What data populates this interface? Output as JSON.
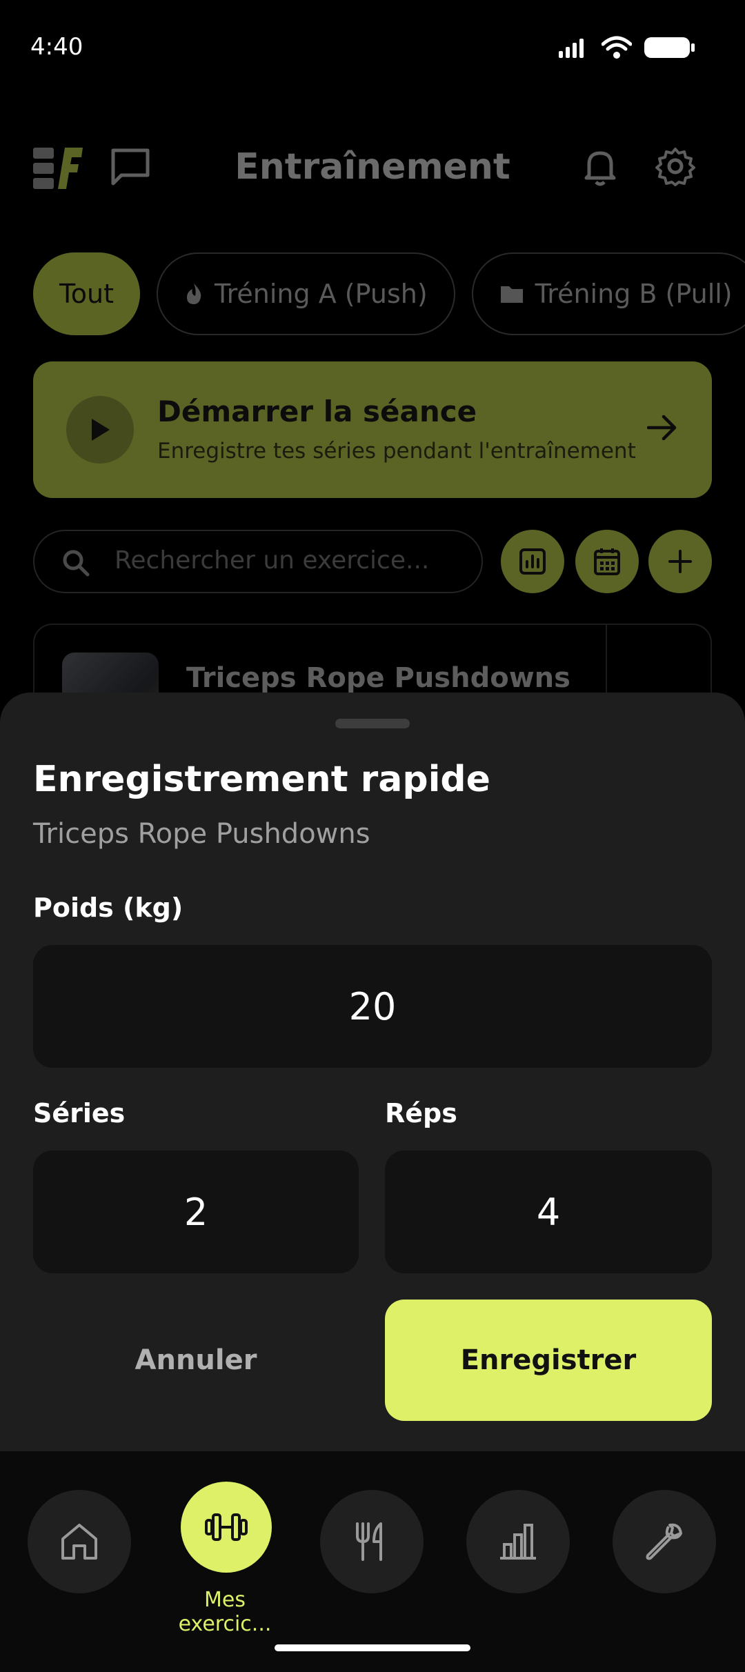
{
  "status": {
    "time": "4:40"
  },
  "header": {
    "title": "Entraînement"
  },
  "filters": [
    {
      "label": "Tout",
      "active": true
    },
    {
      "label": "Tréning A (Push)",
      "icon": "flame-icon"
    },
    {
      "label": "Tréning B (Pull)",
      "icon": "folder-icon"
    }
  ],
  "start_card": {
    "title": "Démarrer la séance",
    "subtitle": "Enregistre tes séries pendant l'entraînement"
  },
  "search": {
    "placeholder": "Rechercher un exercice..."
  },
  "exercise": {
    "name": "Triceps Rope Pushdowns"
  },
  "sheet": {
    "title": "Enregistrement rapide",
    "subtitle": "Triceps Rope Pushdowns",
    "weight_label": "Poids (kg)",
    "weight_value": "20",
    "sets_label": "Séries",
    "sets_value": "2",
    "reps_label": "Réps",
    "reps_value": "4",
    "cancel_label": "Annuler",
    "save_label": "Enregistrer"
  },
  "nav": {
    "items": [
      "home-icon",
      "dumbbell-icon",
      "fork-knife-icon",
      "bar-chart-icon",
      "wrench-icon"
    ],
    "active_label": "Mes exercic..."
  },
  "colors": {
    "accent": "#def067",
    "accent_dim": "#5b6325",
    "sheet_bg": "#1e1e1e",
    "field_bg": "#121212"
  }
}
